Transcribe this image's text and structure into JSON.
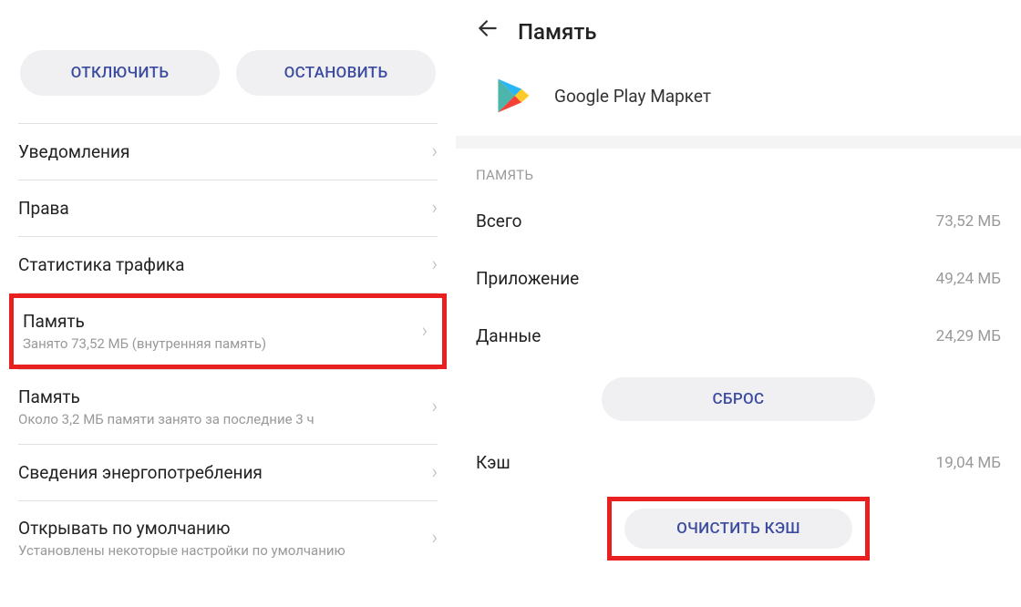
{
  "left": {
    "buttons": {
      "disable": "ОТКЛЮЧИТЬ",
      "stop": "ОСТАНОВИТЬ"
    },
    "items": [
      {
        "title": "Уведомления",
        "sub": null
      },
      {
        "title": "Права",
        "sub": null
      },
      {
        "title": "Статистика трафика",
        "sub": null
      },
      {
        "title": "Память",
        "sub": "Занято 73,52 МБ (внутренняя память)"
      },
      {
        "title": "Память",
        "sub": "Около 3,2 МБ памяти занято за последние 3 ч"
      },
      {
        "title": "Сведения энергопотребления",
        "sub": null
      },
      {
        "title": "Открывать по умолчанию",
        "sub": "Установлены некоторые настройки по умолчанию"
      }
    ]
  },
  "right": {
    "title": "Память",
    "app_name": "Google Play Маркет",
    "section": "ПАМЯТЬ",
    "rows": [
      {
        "label": "Всего",
        "value": "73,52 МБ"
      },
      {
        "label": "Приложение",
        "value": "49,24 МБ"
      },
      {
        "label": "Данные",
        "value": "24,29 МБ"
      }
    ],
    "reset_btn": "СБРОС",
    "cache": {
      "label": "Кэш",
      "value": "19,04 МБ"
    },
    "clear_btn": "ОЧИСТИТЬ КЭШ"
  }
}
